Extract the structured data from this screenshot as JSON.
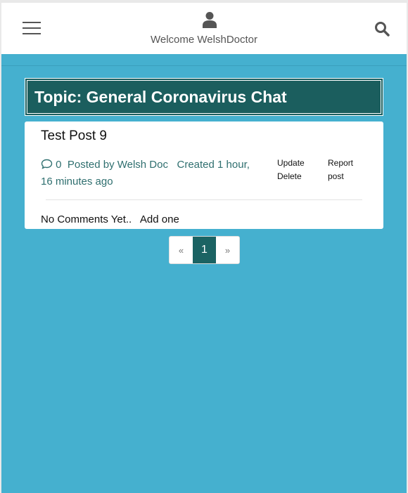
{
  "header": {
    "welcome": "Welcome WelshDoctor",
    "icons": {
      "menu": "hamburger-icon",
      "user": "user-icon",
      "search": "search-icon"
    }
  },
  "topic": {
    "title": "Topic: General Coronavirus Chat"
  },
  "post": {
    "title": "Test Post 9",
    "comment_count": "0",
    "posted_by": "Posted by Welsh Doc",
    "created": "Created 1 hour, 16 minutes ago",
    "update_label": "Update",
    "delete_label": "Delete",
    "report_label": "Report post",
    "no_comments": "No Comments Yet..",
    "add_one": "Add one"
  },
  "pagination": {
    "prev": "«",
    "current": "1",
    "next": "»"
  },
  "colors": {
    "background": "#45b0cf",
    "topic_bg": "#1b5e5e",
    "active_page": "#1b6363",
    "meta_text": "#2f6f6f"
  }
}
